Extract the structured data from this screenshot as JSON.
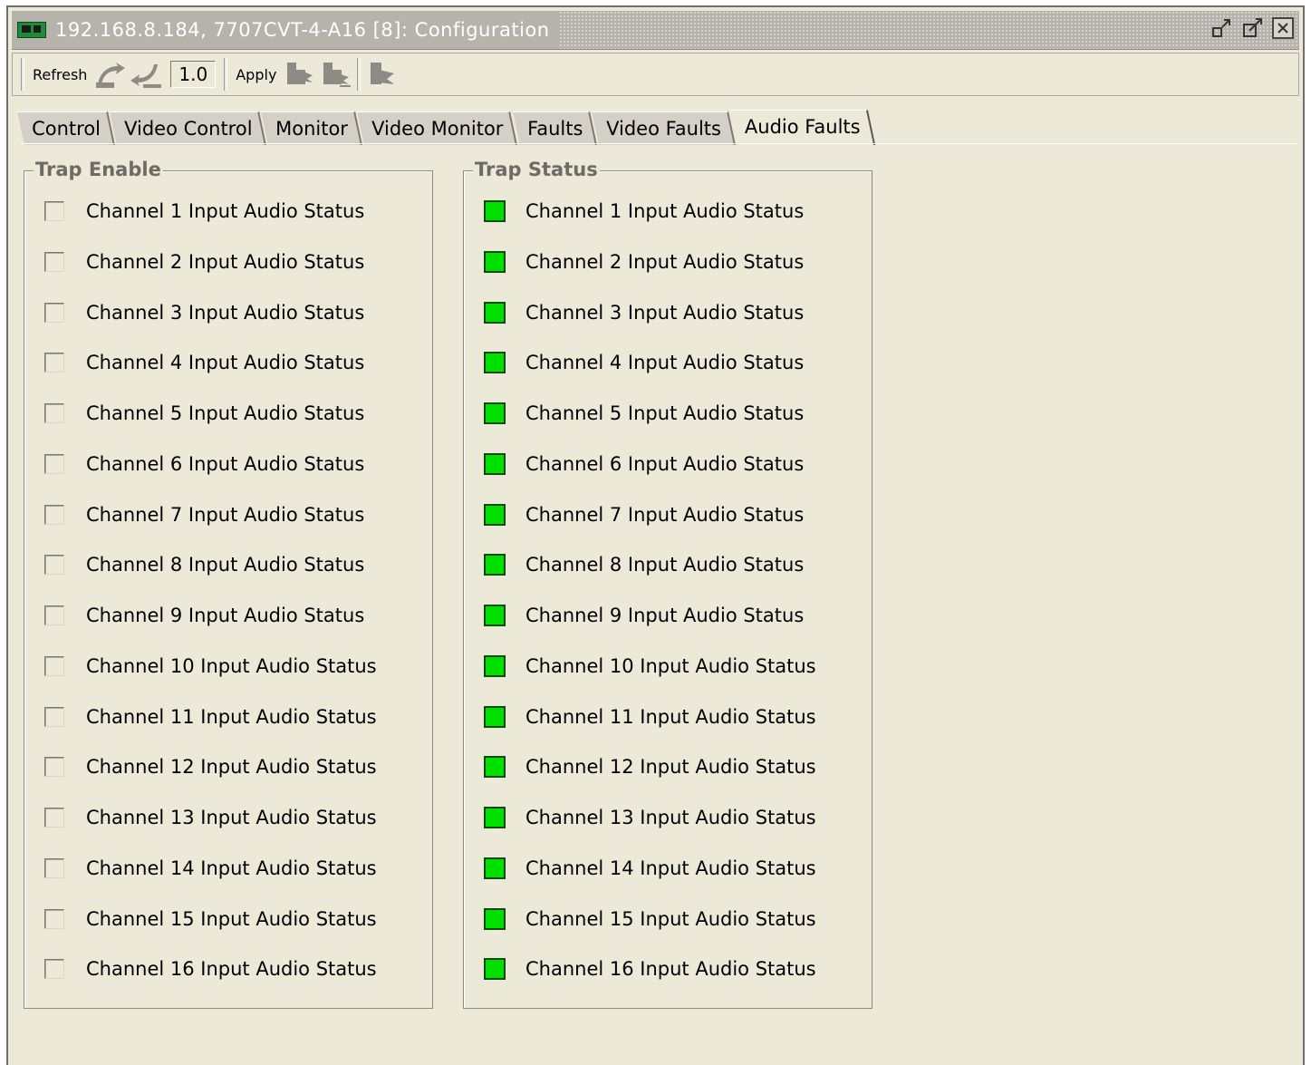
{
  "window": {
    "title": "192.168.8.184, 7707CVT-4-A16 [8]: Configuration",
    "controls": [
      "restore-icon",
      "maximize-icon",
      "close-icon"
    ]
  },
  "toolbar": {
    "refresh_label": "Refresh",
    "version": "1.0",
    "apply_label": "Apply"
  },
  "tabs": [
    {
      "label": "Control"
    },
    {
      "label": "Video Control"
    },
    {
      "label": "Monitor"
    },
    {
      "label": "Video Monitor"
    },
    {
      "label": "Faults"
    },
    {
      "label": "Video Faults"
    },
    {
      "label": "Audio Faults",
      "active": true
    }
  ],
  "trap_enable": {
    "title": "Trap Enable",
    "items": [
      {
        "label": "Channel 1 Input Audio Status",
        "checked": false
      },
      {
        "label": "Channel 2 Input Audio Status",
        "checked": false
      },
      {
        "label": "Channel 3 Input Audio Status",
        "checked": false
      },
      {
        "label": "Channel 4 Input Audio Status",
        "checked": false
      },
      {
        "label": "Channel 5 Input Audio Status",
        "checked": false
      },
      {
        "label": "Channel 6 Input Audio Status",
        "checked": false
      },
      {
        "label": "Channel 7 Input Audio Status",
        "checked": false
      },
      {
        "label": "Channel 8 Input Audio Status",
        "checked": false
      },
      {
        "label": "Channel 9 Input Audio Status",
        "checked": false
      },
      {
        "label": "Channel 10 Input Audio Status",
        "checked": false
      },
      {
        "label": "Channel 11 Input Audio Status",
        "checked": false
      },
      {
        "label": "Channel 12 Input Audio Status",
        "checked": false
      },
      {
        "label": "Channel 13 Input Audio Status",
        "checked": false
      },
      {
        "label": "Channel 14 Input Audio Status",
        "checked": false
      },
      {
        "label": "Channel 15 Input Audio Status",
        "checked": false
      },
      {
        "label": "Channel 16 Input Audio Status",
        "checked": false
      }
    ]
  },
  "trap_status": {
    "title": "Trap Status",
    "status_color": "#00e000",
    "items": [
      {
        "label": "Channel 1 Input Audio Status"
      },
      {
        "label": "Channel 2 Input Audio Status"
      },
      {
        "label": "Channel 3 Input Audio Status"
      },
      {
        "label": "Channel 4 Input Audio Status"
      },
      {
        "label": "Channel 5 Input Audio Status"
      },
      {
        "label": "Channel 6 Input Audio Status"
      },
      {
        "label": "Channel 7 Input Audio Status"
      },
      {
        "label": "Channel 8 Input Audio Status"
      },
      {
        "label": "Channel 9 Input Audio Status"
      },
      {
        "label": "Channel 10 Input Audio Status"
      },
      {
        "label": "Channel 11 Input Audio Status"
      },
      {
        "label": "Channel 12 Input Audio Status"
      },
      {
        "label": "Channel 13 Input Audio Status"
      },
      {
        "label": "Channel 14 Input Audio Status"
      },
      {
        "label": "Channel 15 Input Audio Status"
      },
      {
        "label": "Channel 16 Input Audio Status"
      }
    ]
  }
}
